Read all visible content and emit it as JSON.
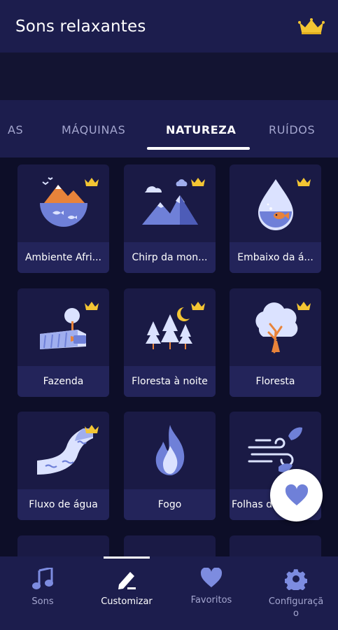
{
  "header": {
    "title": "Sons relaxantes"
  },
  "tabs": [
    {
      "label": "AS"
    },
    {
      "label": "MÁQUINAS"
    },
    {
      "label": "NATUREZA"
    },
    {
      "label": "RUÍDOS"
    }
  ],
  "active_tab": "NATUREZA",
  "cards": [
    {
      "label": "Ambiente Afri...",
      "icon": "african-savanna-icon",
      "premium": true
    },
    {
      "label": "Chirp da mon...",
      "icon": "mountain-icon",
      "premium": true
    },
    {
      "label": "Embaixo da á...",
      "icon": "water-drop-fish-icon",
      "premium": true
    },
    {
      "label": "Fazenda",
      "icon": "farm-icon",
      "premium": true
    },
    {
      "label": "Floresta à noite",
      "icon": "night-forest-icon",
      "premium": true
    },
    {
      "label": "Floresta",
      "icon": "tree-icon",
      "premium": true
    },
    {
      "label": "Fluxo de água",
      "icon": "water-stream-icon",
      "premium": true
    },
    {
      "label": "Fogo",
      "icon": "fire-icon",
      "premium": false
    },
    {
      "label": "Folhas d",
      "icon": "wind-leaves-icon",
      "premium": false
    }
  ],
  "bottom_nav": [
    {
      "label": "Sons",
      "icon": "music-note-icon"
    },
    {
      "label": "Customizar",
      "icon": "pencil-icon"
    },
    {
      "label": "Favoritos",
      "icon": "heart-icon"
    },
    {
      "label": "Configuraçã\no",
      "icon": "gear-icon"
    }
  ],
  "active_nav": "Customizar",
  "colors": {
    "background": "#0d0e28",
    "surface": "#1c1d4d",
    "card": "#1a1a45",
    "card_label": "#23245a",
    "accent_gold": "#f3c533",
    "inactive_text": "#a4a6cf",
    "icon_blue": "#7d8ce0"
  }
}
